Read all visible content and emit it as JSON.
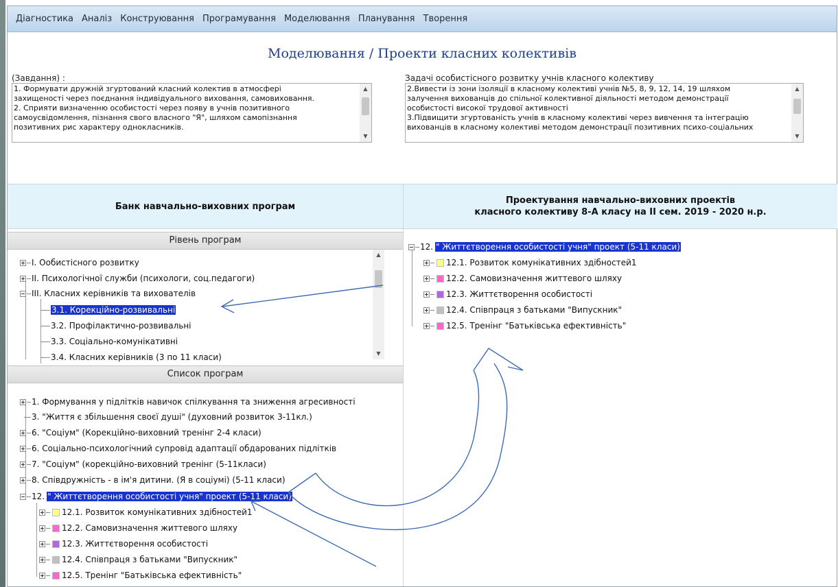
{
  "menu": [
    "Діагностика",
    "Аналіз",
    "Конструювання",
    "Програмування",
    "Моделювання",
    "Планування",
    "Творення"
  ],
  "page_title": "Моделювання / Проекти класних колективів",
  "tasks": {
    "label": "(Завдання) :",
    "lines": [
      "1. Формувати дружній згуртований класний колектив в атмосфері",
      "захищеності через поєднання індивідуального виховання, самовиховання.",
      "2. Сприяти  визначенню особистості через появу  в учнів позитивного",
      "самоусвідомлення,  пізнання  свого власного  \"Я\", шляхом самопізнання",
      "позитивних рис характеру однокласників."
    ]
  },
  "personal_goals": {
    "label": "Задачі особистісного розвитку учнів класного колективу",
    "lines": [
      "2.Вивести із зони ізоляції в класному колективі учнів №5, 8, 9, 12, 14, 19 шляхом",
      "залучення вихованців до спільної колективної діяльності методом демонстрації",
      "особистості високої трудової активності",
      "3.Підвищити згуртованість учнів в класному колективі через вивчення та інтеграцію",
      "вихованців в класному колективі методом демонстрації позитивних психо-соціальних"
    ]
  },
  "left_panel": {
    "title": "Банк навчально-виховних програм",
    "levels_header": "Рівень програм",
    "levels": [
      "I. Оoбистісного розвитку",
      "II. Психологічної служби (психологи, соц.педагоги)",
      "III. Класних керівників та вихователів",
      "3.1. Корекційно-розвивальні",
      "3.2. Профілактично-розвивальні",
      "3.3. Соціально-комунікативні",
      "3.4. Класних керівників (3 по 11 класи)"
    ],
    "list_header": "Список програм",
    "programs": [
      "1. Формування у підлітків навичок спілкування та зниження  агресивності",
      "3. \"Життя є збільшення своєї душі\" (духовний розвиток 3-11кл.)",
      "6. \"Соціум\" (Корекційно-виховний тренінг 2-4 класи)",
      "6.  Соціально-психологічний супровід адаптації обдарованих підлітків",
      "7. \"Соціум\" (корекційно-виховний тренінг (5-11класи)",
      "8. Співдружність - в ім'я дитини. (Я в соціумі) (5-11 класи)",
      "12.",
      "\" Життєтворення особистості учня\" проект (5-11 класи)"
    ],
    "subprograms": [
      "12.1. Розвиток комунікативних здібностей1",
      "12.2. Самовизначення життевого шляху",
      "12.3. Життєтворення особистості",
      "12.4. Співпраця з батьками \"Випускник\"",
      "12.5. Тренінг \"Батьківська ефективність\""
    ]
  },
  "right_panel": {
    "title_line1": "Проектування навчально-виховних проектів",
    "title_line2": "класного колективу 8-А класу на II сем. 2019 - 2020 н.р.",
    "root_num": "12.",
    "root_label": "\" Життєтворення особистості учня\" проект (5-11 класи)",
    "items": [
      "12.1. Розвиток комунікативних здібностей1",
      "12.2. Самовизначення життевого шляху",
      "12.3. Життєтворення особистості",
      "12.4. Співпраця з батьками \"Випускник\"",
      "12.5. Тренінг \"Батьківська ефективність\""
    ]
  },
  "colors": {
    "highlight": "#1a33cc",
    "sub_colors": [
      "#ffff80",
      "#ff66cc",
      "#b266e6",
      "#c0c0c0",
      "#ff66cc"
    ],
    "arrow": "#3d6bb3"
  }
}
